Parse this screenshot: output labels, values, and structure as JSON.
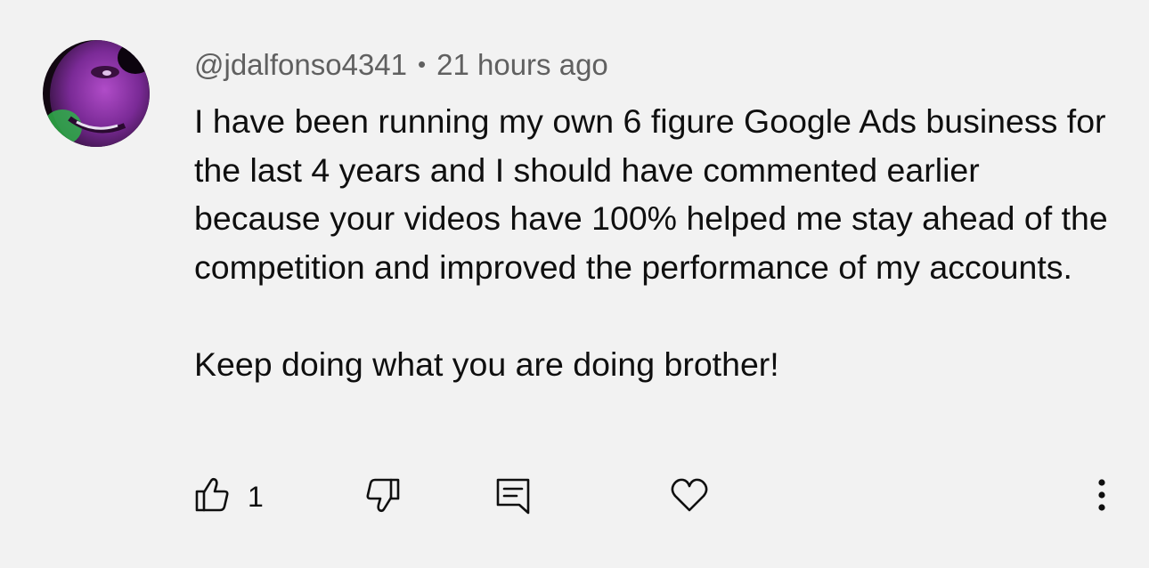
{
  "comment": {
    "author": "@jdalfonso4341",
    "separator": "•",
    "timestamp": "21 hours ago",
    "body_paragraphs": [
      "I have been running my own 6 figure Google Ads business for the last 4 years and I should have commented earlier because your videos have 100% helped me stay ahead of the competition and improved the performance of my accounts.",
      "Keep doing what you are doing brother!"
    ],
    "like_count": "1",
    "icons": {
      "like": "thumbs-up-icon",
      "dislike": "thumbs-down-icon",
      "reply": "reply-comment-icon",
      "heart": "heart-icon",
      "more": "more-vertical-icon"
    },
    "colors": {
      "background": "#f2f2f2",
      "text": "#0f0f0f",
      "meta": "#606060"
    }
  }
}
